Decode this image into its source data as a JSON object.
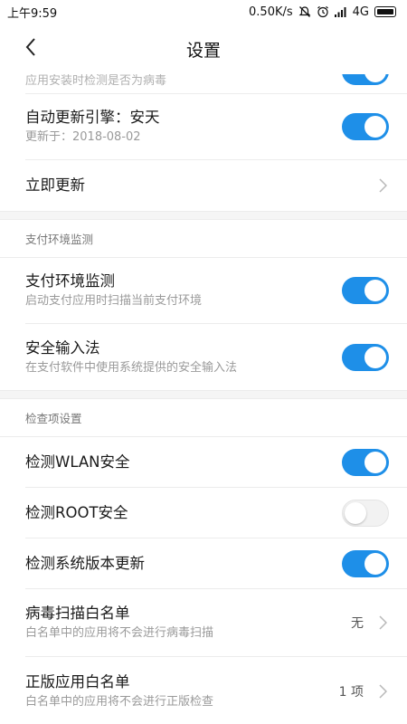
{
  "statusbar": {
    "time": "上午9:59",
    "speed": "0.50K/s",
    "network": "4G"
  },
  "header": {
    "title": "设置"
  },
  "partial_row": {
    "subtitle": "应用安装时检测是否为病毒",
    "toggle_on": true
  },
  "engine_row": {
    "title": "自动更新引擎：安天",
    "subtitle": "更新于：2018-08-02",
    "toggle_on": true
  },
  "update_now": {
    "title": "立即更新"
  },
  "payment_section": {
    "header": "支付环境监测",
    "items": [
      {
        "title": "支付环境监测",
        "subtitle": "启动支付应用时扫描当前支付环境",
        "toggle_on": true
      },
      {
        "title": "安全输入法",
        "subtitle": "在支付软件中使用系统提供的安全输入法",
        "toggle_on": true
      }
    ]
  },
  "check_section": {
    "header": "检查项设置",
    "toggles": [
      {
        "title": "检测WLAN安全",
        "toggle_on": true
      },
      {
        "title": "检测ROOT安全",
        "toggle_on": false
      },
      {
        "title": "检测系统版本更新",
        "toggle_on": true
      }
    ],
    "lists": [
      {
        "title": "病毒扫描白名单",
        "subtitle": "白名单中的应用将不会进行病毒扫描",
        "value": "无"
      },
      {
        "title": "正版应用白名单",
        "subtitle": "白名单中的应用将不会进行正版检查",
        "value": "1 项"
      }
    ]
  },
  "colors": {
    "accent": "#1e8fe8",
    "divider": "#ececec",
    "section_bg": "#f5f5f5"
  }
}
